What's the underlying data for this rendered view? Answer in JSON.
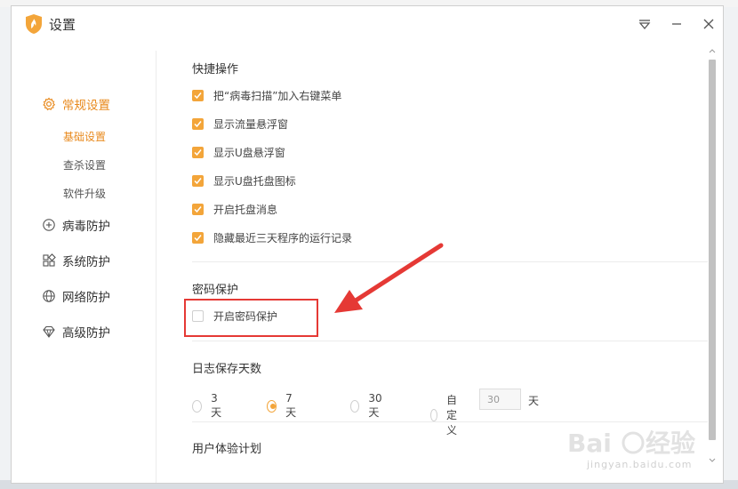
{
  "window": {
    "title": "设置",
    "controls": [
      "menu-icon",
      "minimize-icon",
      "close-icon"
    ]
  },
  "sidebar": {
    "groups": [
      {
        "label": "常规设置",
        "icon": "gear-icon",
        "active": true,
        "children": [
          {
            "label": "基础设置",
            "active": true
          },
          {
            "label": "查杀设置",
            "active": false
          },
          {
            "label": "软件升级",
            "active": false
          }
        ]
      },
      {
        "label": "病毒防护",
        "icon": "plus-square-icon",
        "active": false
      },
      {
        "label": "系统防护",
        "icon": "grid-icon",
        "active": false
      },
      {
        "label": "网络防护",
        "icon": "globe-icon",
        "active": false
      },
      {
        "label": "高级防护",
        "icon": "diamond-icon",
        "active": false
      }
    ]
  },
  "quick_ops": {
    "title": "快捷操作",
    "items": [
      {
        "label": "把“病毒扫描”加入右键菜单",
        "checked": true
      },
      {
        "label": "显示流量悬浮窗",
        "checked": true
      },
      {
        "label": "显示U盘悬浮窗",
        "checked": true
      },
      {
        "label": "显示U盘托盘图标",
        "checked": true
      },
      {
        "label": "开启托盘消息",
        "checked": true
      },
      {
        "label": "隐藏最近三天程序的运行记录",
        "checked": true
      }
    ]
  },
  "password": {
    "title": "密码保护",
    "item": {
      "label": "开启密码保护",
      "checked": false
    }
  },
  "log_days": {
    "title": "日志保存天数",
    "options": [
      {
        "label": "3天",
        "selected": false
      },
      {
        "label": "7天",
        "selected": true
      },
      {
        "label": "30天",
        "selected": false
      },
      {
        "label": "自定义",
        "selected": false
      }
    ],
    "custom_value": "30",
    "unit": "天"
  },
  "ux_plan": {
    "title": "用户体验计划"
  },
  "watermark": {
    "text": "jingyan.baidu.com",
    "brand": "Baidu 经验"
  },
  "colors": {
    "accent": "#f3a53a",
    "accent_text": "#e8891c",
    "annotation": "#e53935"
  }
}
